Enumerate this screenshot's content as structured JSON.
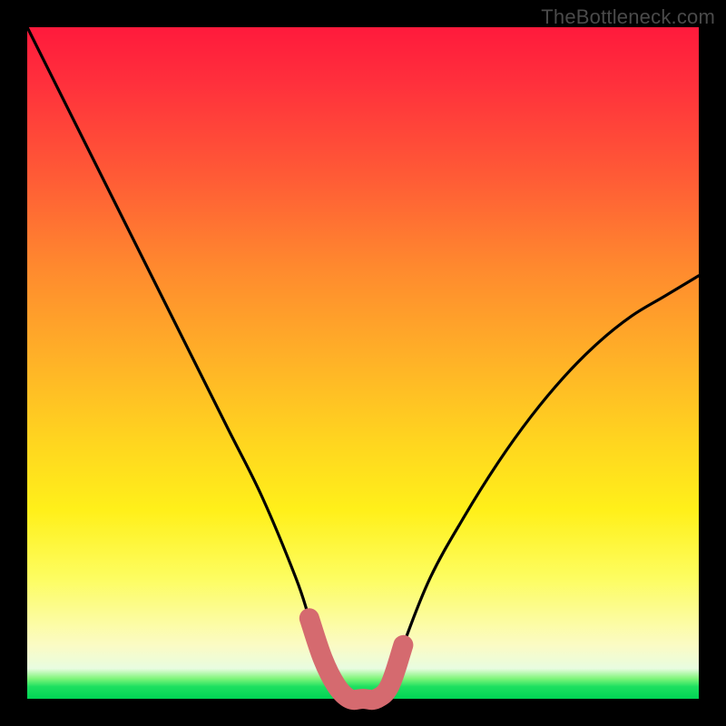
{
  "watermark": {
    "text": "TheBottleneck.com"
  },
  "colors": {
    "frame": "#000000",
    "curve": "#000000",
    "highlight": "#d56a6f",
    "gradient_top": "#ff1a3c",
    "gradient_bottom": "#00d455"
  },
  "chart_data": {
    "type": "line",
    "title": "",
    "xlabel": "",
    "ylabel": "",
    "xlim": [
      0,
      100
    ],
    "ylim": [
      0,
      100
    ],
    "grid": false,
    "legend": false,
    "series": [
      {
        "name": "bottleneck-curve",
        "x": [
          0,
          5,
          10,
          15,
          20,
          25,
          30,
          35,
          40,
          42,
          44,
          46,
          48,
          50,
          52,
          54,
          56,
          60,
          65,
          70,
          75,
          80,
          85,
          90,
          95,
          100
        ],
        "values": [
          100,
          90,
          80,
          70,
          60,
          50,
          40,
          30,
          18,
          12,
          6,
          2,
          0,
          0,
          0,
          2,
          8,
          18,
          27,
          35,
          42,
          48,
          53,
          57,
          60,
          63
        ]
      }
    ],
    "highlight_band": {
      "note": "rounded pink segment along the curve near the minimum",
      "x_start": 42,
      "x_end": 56,
      "y_start": 12,
      "y_end": 8
    }
  }
}
